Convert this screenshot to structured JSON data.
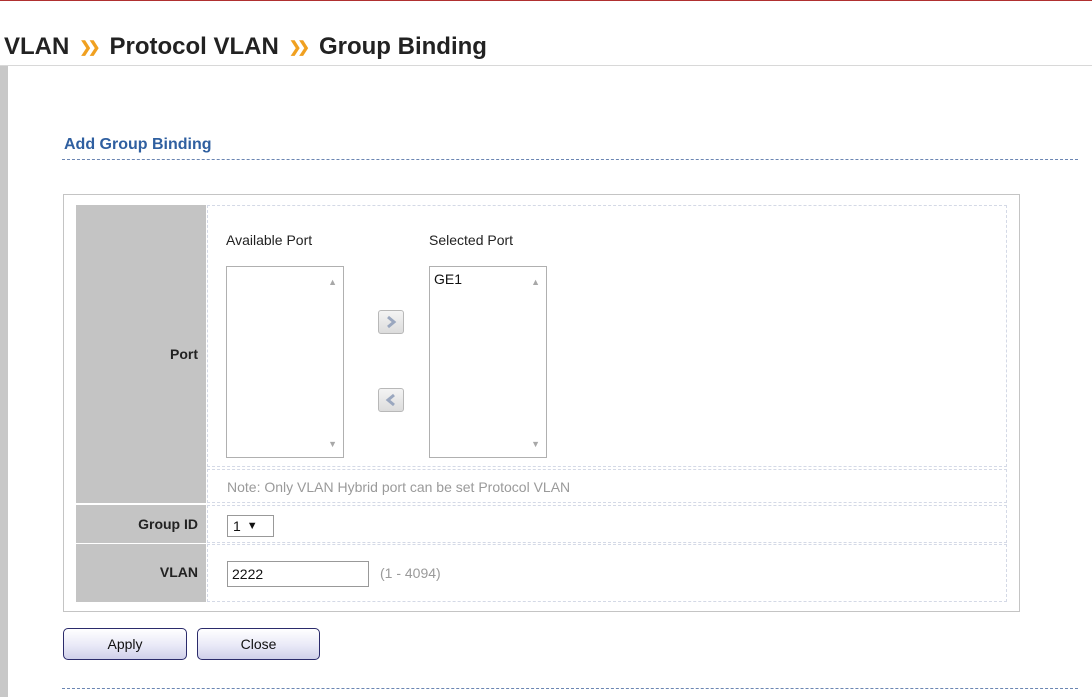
{
  "breadcrumb": {
    "items": [
      "VLAN",
      "Protocol VLAN",
      "Group Binding"
    ],
    "separator": "»"
  },
  "section": {
    "title": "Add Group Binding"
  },
  "port": {
    "label": "Port",
    "available_header": "Available Port",
    "selected_header": "Selected Port",
    "available_items": [],
    "selected_items": [
      "GE1"
    ],
    "note": "Note: Only VLAN Hybrid port can be set Protocol VLAN"
  },
  "group_id": {
    "label": "Group ID",
    "value": "1",
    "arrow": "▼"
  },
  "vlan": {
    "label": "VLAN",
    "value": "2222",
    "range": "(1 - 4094)"
  },
  "buttons": {
    "apply": "Apply",
    "close": "Close"
  },
  "colors": {
    "accent_title": "#2f5fa0",
    "label_bg": "#c4c4c4",
    "separator": "#f0a020",
    "button_border": "#2b2b6b"
  },
  "icons": {
    "move_right": "chevron-right-icon",
    "move_left": "chevron-left-icon",
    "scroll_up": "scroll-up-icon",
    "scroll_down": "scroll-down-icon"
  }
}
